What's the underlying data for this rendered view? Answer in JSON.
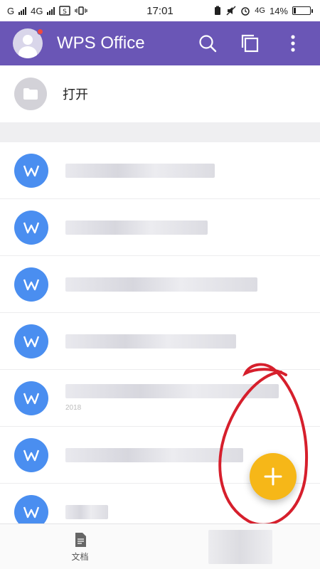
{
  "status_bar": {
    "carrier1": "G",
    "carrier2": "4G",
    "time": "17:01",
    "network": "4G",
    "battery": "14%",
    "battery_level": 0.14
  },
  "app_bar": {
    "title": "WPS Office",
    "avatar_icon": "avatar-icon",
    "actions": [
      "search-icon",
      "multi-window-icon",
      "more-vert-icon"
    ],
    "accent_color": "#6a56b6",
    "notification_color": "#f04a3e"
  },
  "open_row": {
    "label": "打开",
    "icon": "folder-icon"
  },
  "documents": {
    "icon": "wps-writer-icon",
    "icon_color": "#4a8ef0",
    "items": [
      {
        "title_state": "obscured"
      },
      {
        "title_state": "obscured"
      },
      {
        "title_state": "obscured"
      },
      {
        "title_state": "obscured"
      },
      {
        "title_state": "obscured",
        "subtitle_prefix": "2018"
      },
      {
        "title_state": "obscured"
      },
      {
        "title_state": "obscured"
      }
    ]
  },
  "fab": {
    "icon": "plus-icon",
    "color": "#f6b718",
    "annotation_color": "#d61f2c"
  },
  "bottom_nav": {
    "tabs": [
      {
        "label": "文档",
        "icon": "document-icon"
      },
      {
        "label": "",
        "icon": "obscured"
      }
    ]
  }
}
